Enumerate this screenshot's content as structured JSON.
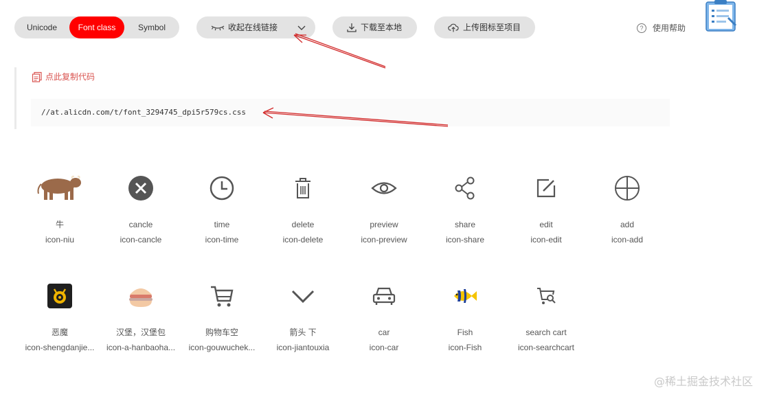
{
  "toolbar": {
    "tabs": [
      {
        "label": "Unicode"
      },
      {
        "label": "Font class"
      },
      {
        "label": "Symbol"
      }
    ],
    "collapse_label": "收起在线链接",
    "download_label": "下载至本地",
    "upload_label": "上传图标至项目",
    "help_label": "使用帮助",
    "active_tab_color": "#ff0000"
  },
  "code": {
    "copy_label": "点此复制代码",
    "url": "//at.alicdn.com/t/font_3294745_dpi5r579cs.css"
  },
  "icons": [
    {
      "name": "牛",
      "class": "icon-niu",
      "icon": "cow-icon"
    },
    {
      "name": "cancle",
      "class": "icon-cancle",
      "icon": "cancel-icon"
    },
    {
      "name": "time",
      "class": "icon-time",
      "icon": "clock-icon"
    },
    {
      "name": "delete",
      "class": "icon-delete",
      "icon": "trash-icon"
    },
    {
      "name": "preview",
      "class": "icon-preview",
      "icon": "eye-icon"
    },
    {
      "name": "share",
      "class": "icon-share",
      "icon": "share-icon"
    },
    {
      "name": "edit",
      "class": "icon-edit",
      "icon": "edit-icon"
    },
    {
      "name": "add",
      "class": "icon-add",
      "icon": "add-icon"
    },
    {
      "name": "恶魔",
      "class": "icon-shengdanjie...",
      "icon": "demon-icon"
    },
    {
      "name": "汉堡，汉堡包",
      "class": "icon-a-hanbaoha...",
      "icon": "hamburger-icon"
    },
    {
      "name": "购物车空",
      "class": "icon-gouwuchek...",
      "icon": "cart-icon"
    },
    {
      "name": "箭头 下",
      "class": "icon-jiantouxia",
      "icon": "chevron-down-icon"
    },
    {
      "name": "car",
      "class": "icon-car",
      "icon": "car-icon"
    },
    {
      "name": "Fish",
      "class": "icon-Fish",
      "icon": "fish-icon"
    },
    {
      "name": "search cart",
      "class": "icon-searchcart",
      "icon": "search-cart-icon"
    }
  ],
  "watermark": "@稀土掘金技术社区"
}
